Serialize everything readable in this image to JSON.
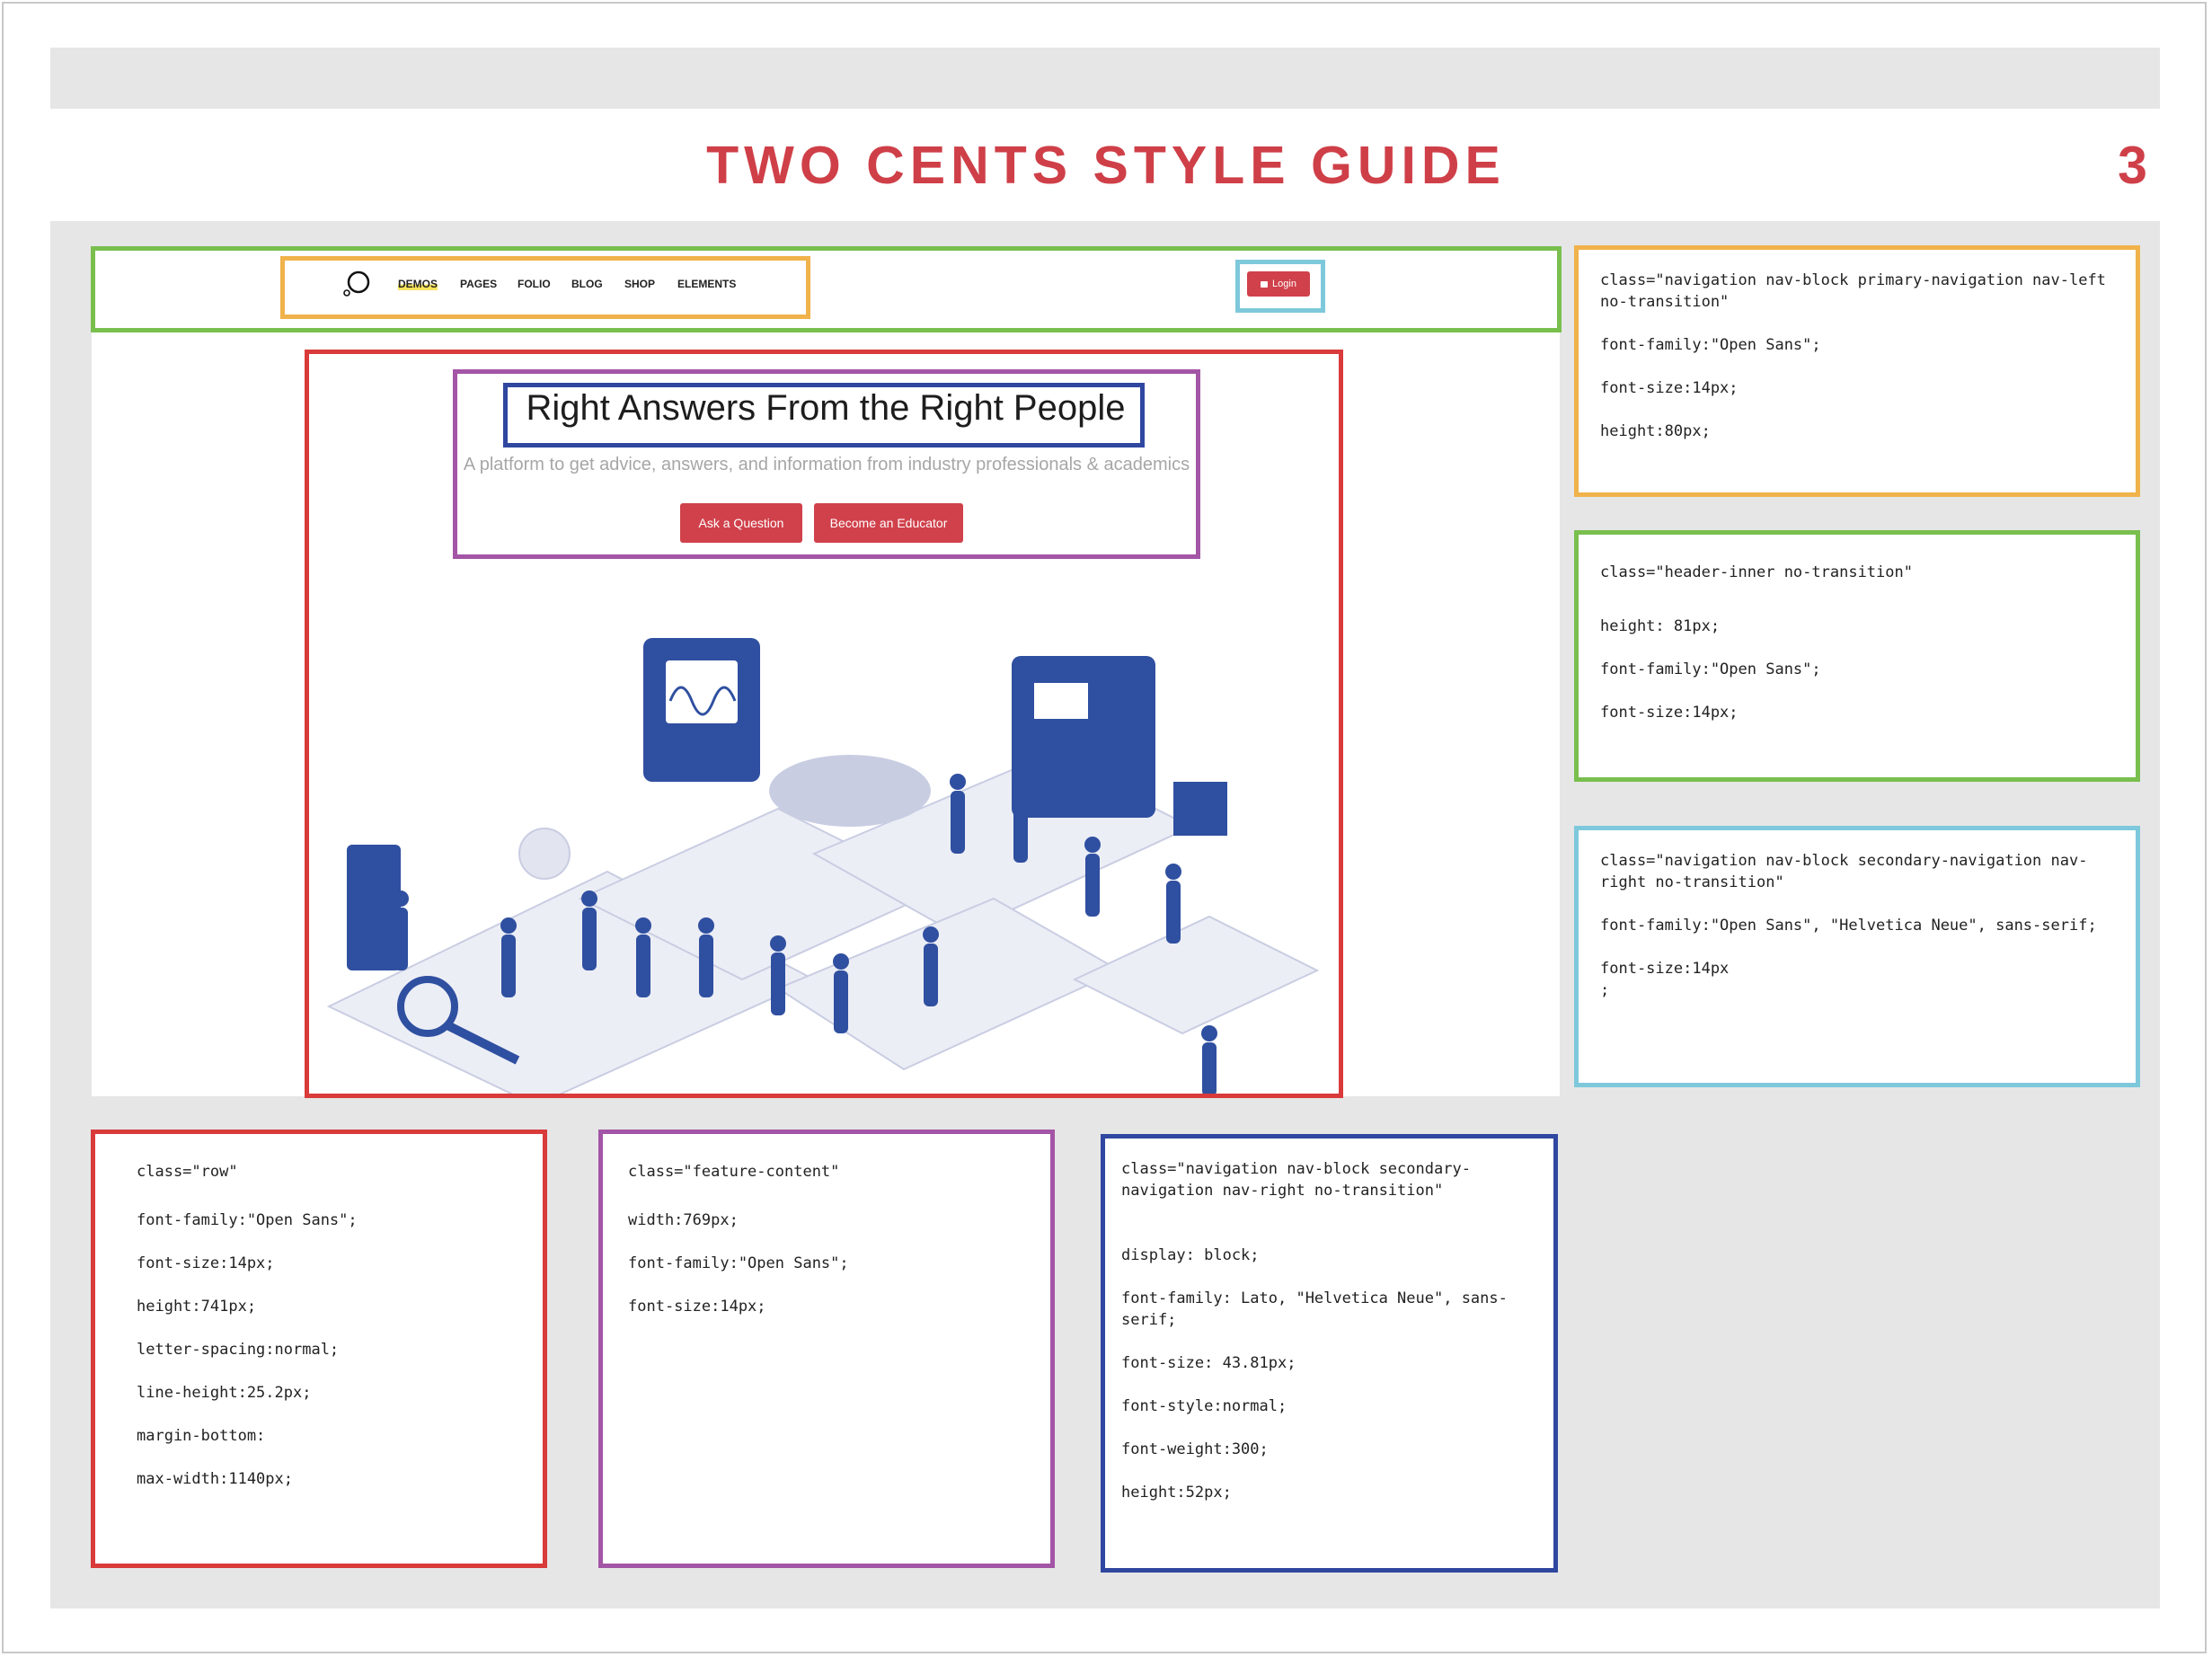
{
  "doc": {
    "title": "TWO CENTS STYLE GUIDE",
    "page_number": "3"
  },
  "site": {
    "nav": [
      "DEMOS",
      "PAGES",
      "FOLIO",
      "BLOG",
      "SHOP",
      "ELEMENTS"
    ],
    "login_label": "Login",
    "hero_title": "Right Answers From the Right People",
    "hero_subtitle": "A platform to get advice, answers, and information from industry professionals & academics",
    "btn_ask": "Ask a Question",
    "btn_educator": "Become an Educator"
  },
  "colors": {
    "accent": "#cf3f48",
    "orange": "#f0b24a",
    "green": "#79bf4e",
    "cyan": "#7ec8dc",
    "red": "#d93a3a",
    "purple": "#a355a6",
    "navy": "#2f47a0"
  },
  "cards": {
    "orange": [
      "class=\"navigation nav-block primary-navigation nav-left no-transition\"",
      "font-family:\"Open Sans\";",
      "font-size:14px;",
      "height:80px;"
    ],
    "green": [
      "class=\"header-inner no-transition\"",
      "height: 81px;",
      "font-family:\"Open Sans\";",
      "font-size:14px;"
    ],
    "cyan": [
      "class=\"navigation nav-block secondary-navigation nav-right no-transition\"",
      "font-family:\"Open Sans\", \"Helvetica Neue\", sans-serif;",
      "font-size:14px",
      ";"
    ],
    "red": [
      "class=\"row\"",
      "font-family:\"Open Sans\";",
      "font-size:14px;",
      "height:741px;",
      "letter-spacing:normal;",
      "line-height:25.2px;",
      "margin-bottom:",
      "max-width:1140px;"
    ],
    "purple": [
      "class=\"feature-content\"",
      "width:769px;",
      "font-family:\"Open Sans\";",
      "font-size:14px;"
    ],
    "navy": [
      "class=\"navigation nav-block secondary-navigation nav-right no-transition\"",
      "display: block;",
      "font-family: Lato, \"Helvetica Neue\", sans-serif;",
      "font-size: 43.81px;",
      "font-style:normal;",
      "font-weight:300;",
      "height:52px;"
    ]
  }
}
